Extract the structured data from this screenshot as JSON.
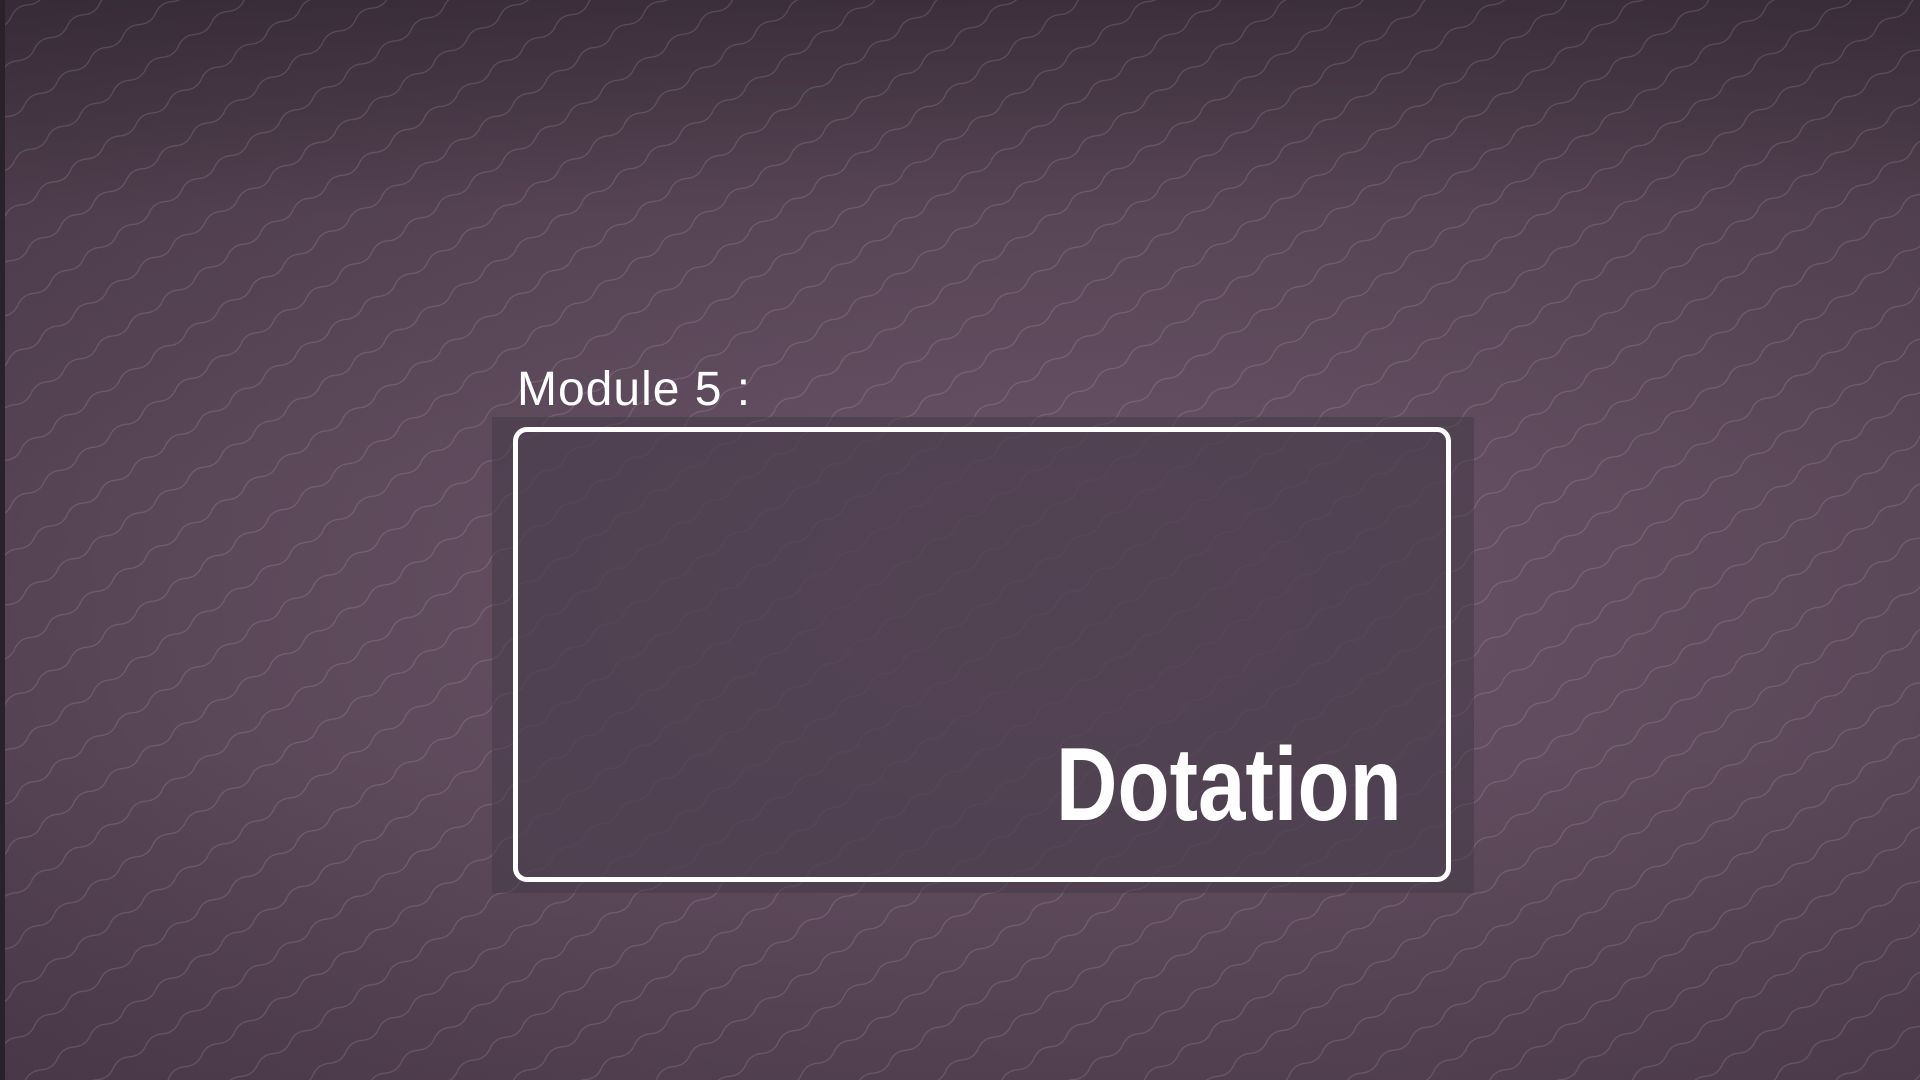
{
  "slide": {
    "module_label": "Module 5 :",
    "card_title": "Dotation"
  },
  "colors": {
    "background": "#5d4a5c",
    "text": "#ffffff",
    "card_border": "#ffffff"
  },
  "icons": [
    "wave-pattern-background"
  ]
}
